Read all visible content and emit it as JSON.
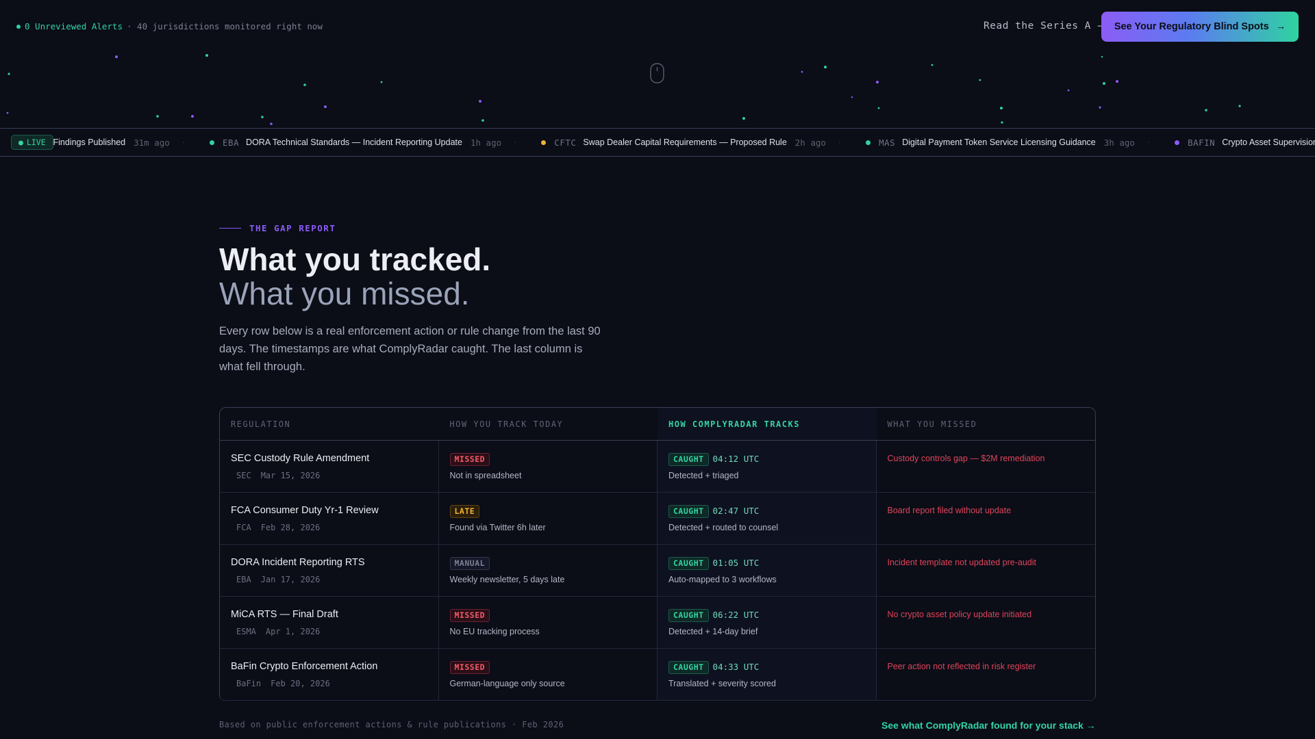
{
  "topbar": {
    "alerts_count": "0 Unreviewed Alerts",
    "alerts_sub": "· 40 jurisdictions monitored right now",
    "series_link": "Read the Series A →",
    "cta_label": "See Your Regulatory Blind Spots",
    "cta_arrow": "→"
  },
  "ticker": {
    "live_label": "LIVE",
    "items": [
      {
        "src": "",
        "title": "New Findings Published",
        "ago": "31m ago",
        "color": "#2fd3a0"
      },
      {
        "src": "EBA",
        "title": "DORA Technical Standards — Incident Reporting Update",
        "ago": "1h ago",
        "color": "#2fd3a0"
      },
      {
        "src": "CFTC",
        "title": "Swap Dealer Capital Requirements — Proposed Rule",
        "ago": "2h ago",
        "color": "#f2b233"
      },
      {
        "src": "MAS",
        "title": "Digital Payment Token Service Licensing Guidance",
        "ago": "3h ago",
        "color": "#2fd3a0"
      },
      {
        "src": "BAFIN",
        "title": "Crypto Asset Supervision",
        "ago": "",
        "color": "#8b5cf6"
      }
    ]
  },
  "hero": {
    "kicker": "THE GAP REPORT",
    "title_line1": "What you tracked.",
    "title_line2": "What you missed.",
    "intro": "Every row below is a real enforcement action or rule change from the last 90 days. The timestamps are what ComplyRadar caught. The last column is what fell through."
  },
  "table": {
    "headers": [
      "REGULATION",
      "HOW YOU TRACK TODAY",
      "HOW COMPLYRADAR TRACKS",
      "WHAT YOU MISSED"
    ],
    "rows": [
      {
        "name": "SEC Custody Rule Amendment",
        "agency": "SEC",
        "date": "Mar 15, 2026",
        "today_badge": "MISSED",
        "today_type": "missed",
        "today_note": "Not in spreadsheet",
        "cr_badge": "CAUGHT",
        "cr_time": "04:12 UTC",
        "cr_note": "Detected + triaged",
        "missed": "Custody controls gap — $2M remediation"
      },
      {
        "name": "FCA Consumer Duty Yr-1 Review",
        "agency": "FCA",
        "date": "Feb 28, 2026",
        "today_badge": "LATE",
        "today_type": "late",
        "today_note": "Found via Twitter 6h later",
        "cr_badge": "CAUGHT",
        "cr_time": "02:47 UTC",
        "cr_note": "Detected + routed to counsel",
        "missed": "Board report filed without update"
      },
      {
        "name": "DORA Incident Reporting RTS",
        "agency": "EBA",
        "date": "Jan 17, 2026",
        "today_badge": "MANUAL",
        "today_type": "manual",
        "today_note": "Weekly newsletter, 5 days late",
        "cr_badge": "CAUGHT",
        "cr_time": "01:05 UTC",
        "cr_note": "Auto-mapped to 3 workflows",
        "missed": "Incident template not updated pre-audit"
      },
      {
        "name": "MiCA RTS — Final Draft",
        "agency": "ESMA",
        "date": "Apr 1, 2026",
        "today_badge": "MISSED",
        "today_type": "missed",
        "today_note": "No EU tracking process",
        "cr_badge": "CAUGHT",
        "cr_time": "06:22 UTC",
        "cr_note": "Detected + 14-day brief",
        "missed": "No crypto asset policy update initiated"
      },
      {
        "name": "BaFin Crypto Enforcement Action",
        "agency": "BaFin",
        "date": "Feb 20, 2026",
        "today_badge": "MISSED",
        "today_type": "missed",
        "today_note": "German-language only source",
        "cr_badge": "CAUGHT",
        "cr_time": "04:33 UTC",
        "cr_note": "Translated + severity scored",
        "missed": "Peer action not reflected in risk register"
      }
    ]
  },
  "footer": {
    "note": "Based on public enforcement actions & rule publications · Feb 2026",
    "link": "See what ComplyRadar found for your stack →"
  },
  "colors": {
    "accent_green": "#2fd3a0",
    "accent_purple": "#8b5cf6",
    "danger": "#e0445a",
    "warning": "#f2b233",
    "background": "#0b0d17"
  }
}
